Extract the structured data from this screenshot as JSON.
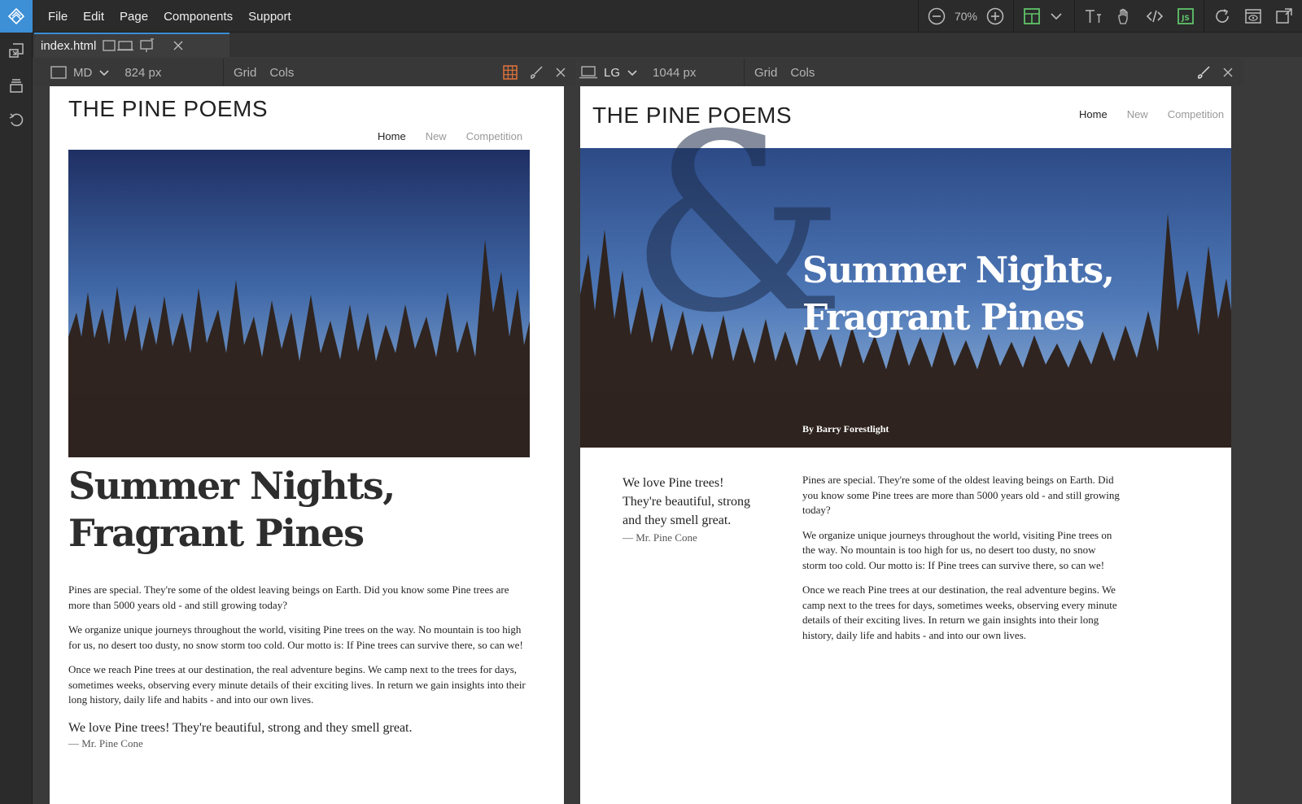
{
  "app": {
    "menu": [
      "File",
      "Edit",
      "Page",
      "Components",
      "Support"
    ],
    "zoom_level": "70%",
    "accent": "#3d8fd6"
  },
  "icons": {
    "toolbar": [
      "zoom-out-icon",
      "zoom-in-icon",
      "layout-icon",
      "chevron-down-icon",
      "text-icon",
      "hand-icon",
      "code-icon",
      "js-icon",
      "refresh-icon",
      "preview-icon",
      "export-icon"
    ],
    "rail": [
      "insert-icon",
      "library-icon",
      "undo-icon"
    ]
  },
  "tab": {
    "label": "index.html"
  },
  "panes": {
    "left": {
      "breakpoint": "MD",
      "width_label": "824 px",
      "grid_label": "Grid",
      "cols_label": "Cols"
    },
    "right": {
      "breakpoint": "LG",
      "width_label": "1044 px",
      "grid_label": "Grid",
      "cols_label": "Cols"
    }
  },
  "site": {
    "title": "THE PINE POEMS",
    "nav": [
      "Home",
      "New",
      "Competition"
    ],
    "headline_line1": "Summer Nights,",
    "headline_line2": "Fragrant Pines",
    "byline": "By Barry Forestlight",
    "ampersand": "&",
    "paragraphs": [
      "Pines are special. They're some of the oldest leaving beings on Earth. Did you know some Pine trees are more than 5000 years old - and still growing today?",
      "We organize unique journeys throughout the world, visiting Pine trees on the way. No mountain is too high for us, no desert too dusty, no snow storm too cold. Our motto is: If Pine trees can survive there, so can we!",
      "Once we reach Pine trees at our destination, the real adventure begins. We camp next to the trees for days, sometimes weeks, observing every minute details of their exciting lives. In return we gain insights into their long history, daily life and habits - and into our own lives."
    ],
    "quote": "We love Pine trees! They're beautiful, strong and they smell great.",
    "quote_author": "— Mr. Pine Cone"
  }
}
